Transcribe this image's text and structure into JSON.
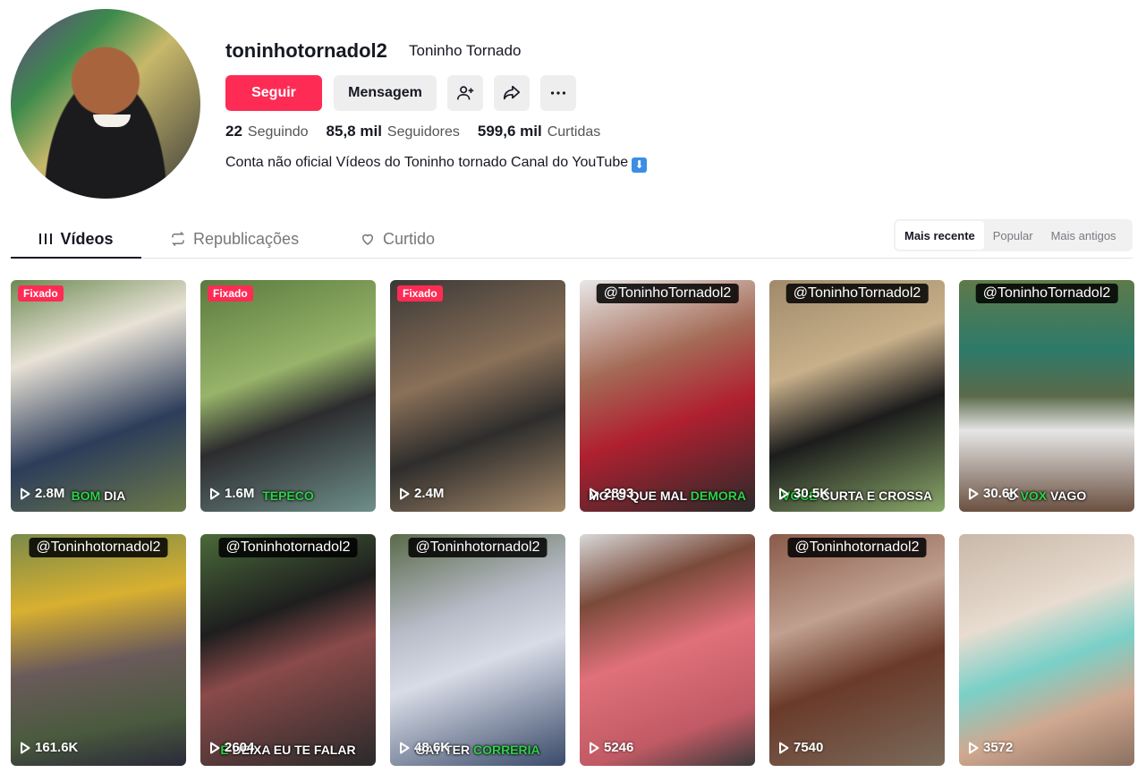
{
  "profile": {
    "username": "toninhotornadol2",
    "nickname": "Toninho Tornado",
    "follow_label": "Seguir",
    "message_label": "Mensagem",
    "stats": [
      {
        "value": "22",
        "label": "Seguindo"
      },
      {
        "value": "85,8 mil",
        "label": "Seguidores"
      },
      {
        "value": "599,6 mil",
        "label": "Curtidas"
      }
    ],
    "bio": "Conta não oficial Vídeos do Toninho tornado Canal do YouTube",
    "bio_emoji": "⬇"
  },
  "tabs": [
    {
      "label": "Vídeos",
      "icon": "grid-icon",
      "active": true
    },
    {
      "label": "Republicações",
      "icon": "repost-icon",
      "active": false
    },
    {
      "label": "Curtido",
      "icon": "heart-icon",
      "active": false
    }
  ],
  "sort_options": [
    "Mais recente",
    "Popular",
    "Mais antigos"
  ],
  "sort_active": "Mais recente",
  "colors": {
    "accent": "#fe2c55",
    "text": "#161823"
  },
  "videos": [
    {
      "views": "2.8M",
      "pinned": "Fixado",
      "watermark": "",
      "caption": [
        {
          "t": "BOM ",
          "g": true
        },
        {
          "t": "DIA",
          "g": false
        }
      ],
      "bg": "linear-gradient(160deg,#6b8a52 0%,#e8e2d6 30%,#2d3d5a 65%,#6c7a4a 100%)"
    },
    {
      "views": "1.6M",
      "pinned": "Fixado",
      "watermark": "",
      "caption": [
        {
          "t": "TEPECO",
          "g": true
        }
      ],
      "bg": "linear-gradient(160deg,#5a7a3e 0%,#98b46a 40%,#2c2c2e 60%,#6f8f8a 100%)"
    },
    {
      "views": "2.4M",
      "pinned": "Fixado",
      "watermark": "",
      "caption": [],
      "bg": "linear-gradient(160deg,#3a3836 0%,#8a7058 40%,#2e2d2c 65%,#a4886a 100%)"
    },
    {
      "views": "2893",
      "pinned": "",
      "watermark": "@ToninhoTornadol2",
      "caption": [
        {
          "t": "MOTO QUE MAL ",
          "g": false
        },
        {
          "t": "DEMORA",
          "g": true
        }
      ],
      "bg": "linear-gradient(160deg,#e8e8e8 0%,#a46a56 35%,#b02030 60%,#2a2a2a 100%)"
    },
    {
      "views": "30.5K",
      "pinned": "",
      "watermark": "@ToninhoTornadol2",
      "caption": [
        {
          "t": "VOCÊ ",
          "g": true
        },
        {
          "t": "CURTA E CROSSA",
          "g": false
        }
      ],
      "bg": "linear-gradient(160deg,#a08a6a 0%,#c8b08a 35%,#1c1c1c 60%,#8aa86a 100%)"
    },
    {
      "views": "30.6K",
      "pinned": "",
      "watermark": "@ToninhoTornadol2",
      "caption": [
        {
          "t": "O ",
          "g": false
        },
        {
          "t": "VOX",
          "g": true
        },
        {
          "t": " VAGO",
          "g": false
        }
      ],
      "bg": "linear-gradient(180deg,#5e7a4a 0%,#2e7a6a 30%,#5a6a4a 50%,#e6e6e6 65%,#6a5040 100%)"
    },
    {
      "views": "161.6K",
      "pinned": "",
      "watermark": "@Toninhotornadol2",
      "caption": [],
      "bg": "linear-gradient(170deg,#7a8a4a 0%,#d8b030 30%,#6a5a5a 55%,#4a5a3e 80%,#2a2a38 100%)"
    },
    {
      "views": "2604",
      "pinned": "",
      "watermark": "@Toninhotornadol2",
      "caption": [
        {
          "t": "É ",
          "g": true
        },
        {
          "t": "DEIXA EU TE FALAR",
          "g": false
        }
      ],
      "bg": "linear-gradient(160deg,#4a6a3a 0%,#1e1e1e 35%,#8a4a4a 55%,#2a2a2a 100%)"
    },
    {
      "views": "48.6K",
      "pinned": "",
      "watermark": "@Toninhotornadol2",
      "caption": [
        {
          "t": "GAY TER ",
          "g": false
        },
        {
          "t": "CORRERIA",
          "g": true
        }
      ],
      "bg": "linear-gradient(160deg,#5a6a4a 0%,#b8bcc8 35%,#d8dce6 55%,#3a4a6a 100%)"
    },
    {
      "views": "5246",
      "pinned": "",
      "watermark": "",
      "caption": [],
      "bg": "linear-gradient(160deg,#d8d8d8 0%,#7a4a3a 25%,#e0707a 50%,#c05a64 80%,#3a3a3a 100%)"
    },
    {
      "views": "7540",
      "pinned": "",
      "watermark": "@Toninhotornadol2",
      "caption": [],
      "bg": "linear-gradient(160deg,#8a5a4a 0%,#c0a090 35%,#6a3a2a 60%,#7a6a5a 100%)"
    },
    {
      "views": "3572",
      "pinned": "",
      "watermark": "",
      "caption": [],
      "bg": "linear-gradient(160deg,#c8b8a8 0%,#e8dcd0 35%,#7ad0c8 55%,#d0a890 75%,#8a7060 100%)"
    }
  ]
}
